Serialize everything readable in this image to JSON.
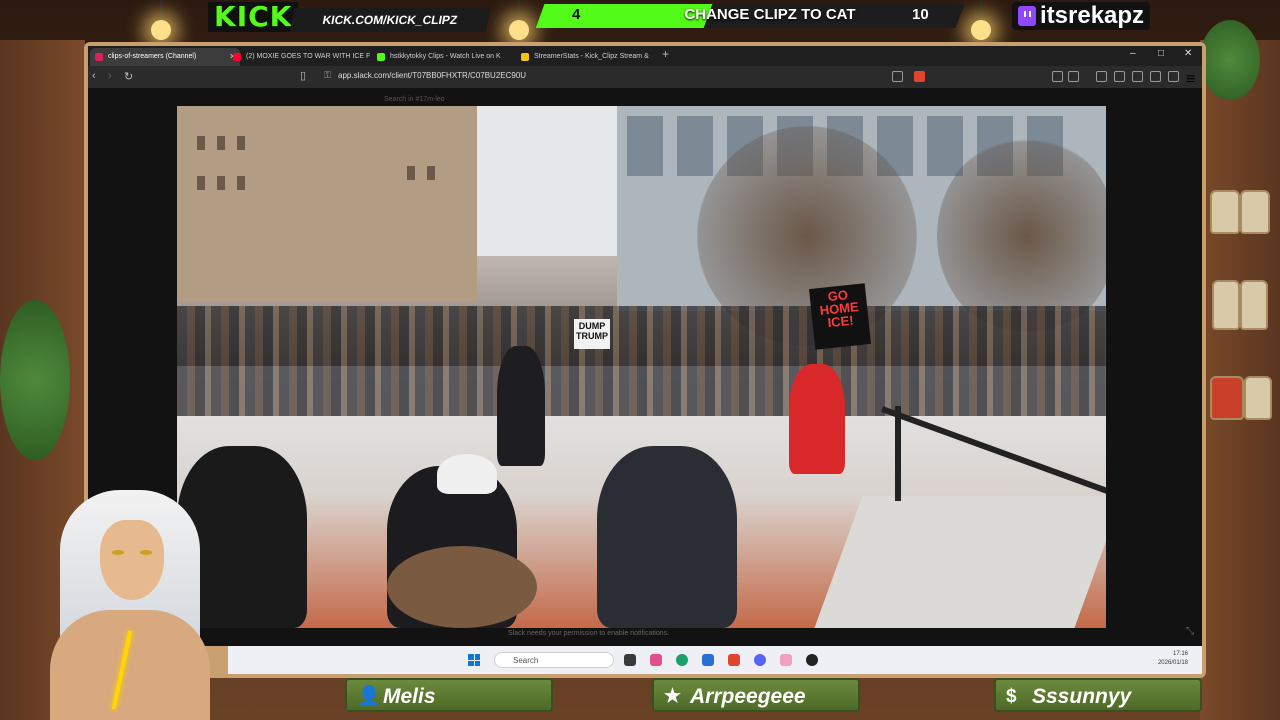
{
  "overlay": {
    "kick_logo": "KICK",
    "kick_url": "KICK.COM/KICK_CLIPZ",
    "goal": {
      "current": "4",
      "text": "CHANGE CLIPZ TO CAT",
      "max": "10",
      "progress": 0.4
    },
    "twitch_name": "itsrekapz"
  },
  "browser": {
    "tabs": [
      {
        "label": "clips-of-streamers (Channel)",
        "active": true,
        "color": "#e01e5a"
      },
      {
        "label": "(2) MOXIE GOES TO WAR WITH ICE F",
        "active": false,
        "color": "#ff0033"
      },
      {
        "label": "hstkkytokky Clips - Watch Live on K",
        "active": false,
        "color": "#53fc18"
      },
      {
        "label": "StreamerStats - Kick_Clipz Stream & ",
        "active": false,
        "color": "#f5c518"
      }
    ],
    "url": "app.slack.com/client/T07BB0FHXTR/C07BU2EC90U",
    "search_placeholder": "Search in #17m-leo",
    "toast": "Slack needs your permission to enable notifications.",
    "video": {
      "sign_main": "GO HOME ICE!",
      "sign_small": "DUMP TRUMP"
    }
  },
  "taskbar": {
    "search_label": "Search",
    "time": "17:16",
    "date": "2026/01/18"
  },
  "plates": [
    {
      "icon": "person-icon",
      "glyph": "👤",
      "label": "Melis"
    },
    {
      "icon": "star-icon",
      "glyph": "★",
      "label": "Arrpeegeee"
    },
    {
      "icon": "dollar-icon",
      "glyph": "$",
      "label": "Sssunnyy"
    }
  ]
}
